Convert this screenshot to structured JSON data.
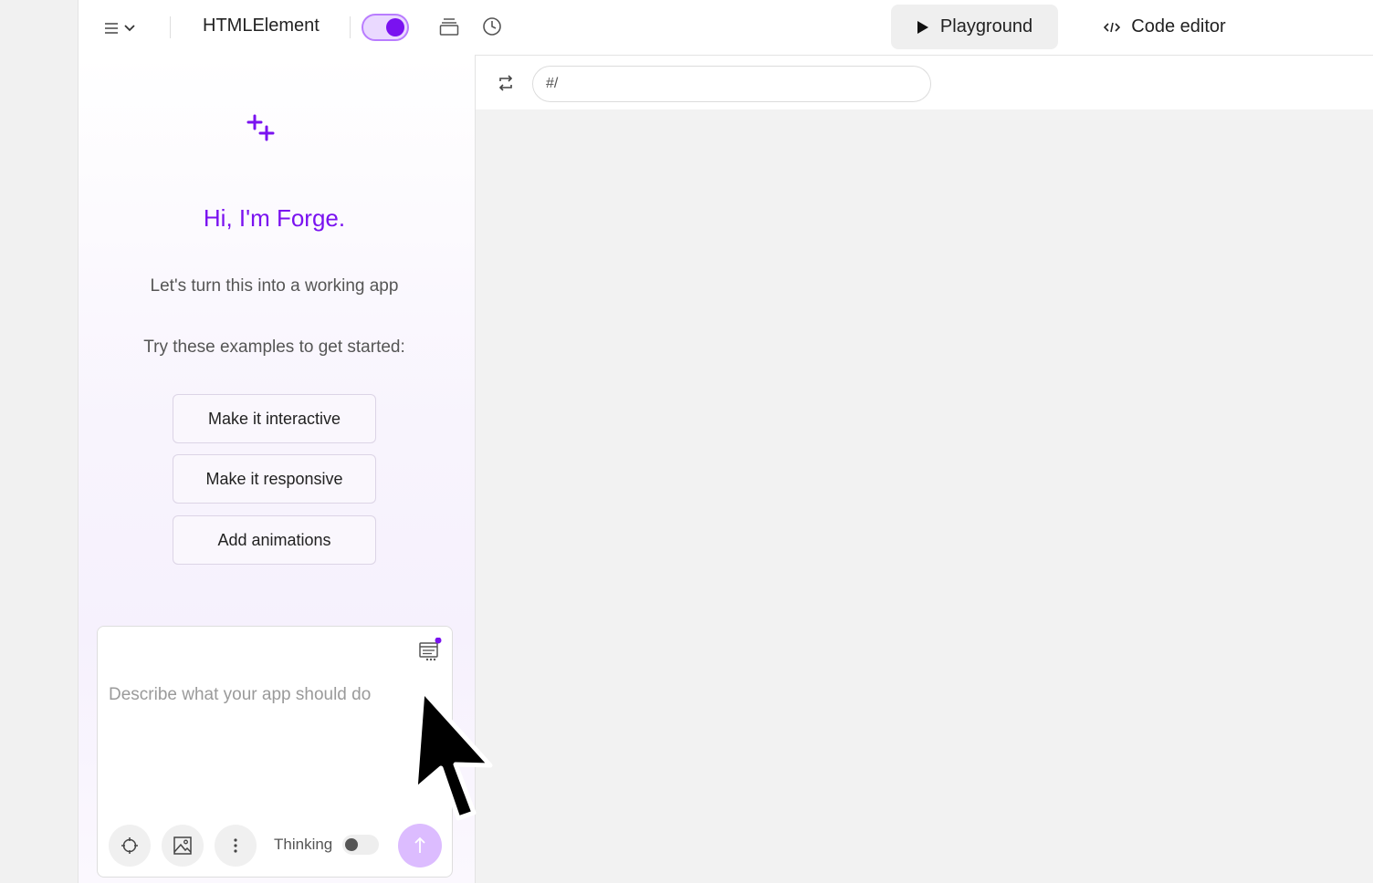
{
  "header": {
    "project_title": "HTMLElement",
    "toggle_on": true,
    "tabs": [
      {
        "label": "Playground",
        "icon": "play-icon",
        "active": true
      },
      {
        "label": "Code editor",
        "icon": "code-icon",
        "active": false
      }
    ]
  },
  "chat": {
    "greeting": "Hi, I'm Forge.",
    "subtitle": "Let's turn this into a working app",
    "examples_title": "Try these examples to get started:",
    "examples": [
      "Make it interactive",
      "Make it responsive",
      "Add animations"
    ],
    "composer": {
      "placeholder": "Describe what your app should do",
      "thinking_label": "Thinking",
      "thinking_on": false
    }
  },
  "preview": {
    "url": "#/"
  },
  "colors": {
    "accent": "#7a12f0",
    "accent_light": "#dcbcff"
  }
}
